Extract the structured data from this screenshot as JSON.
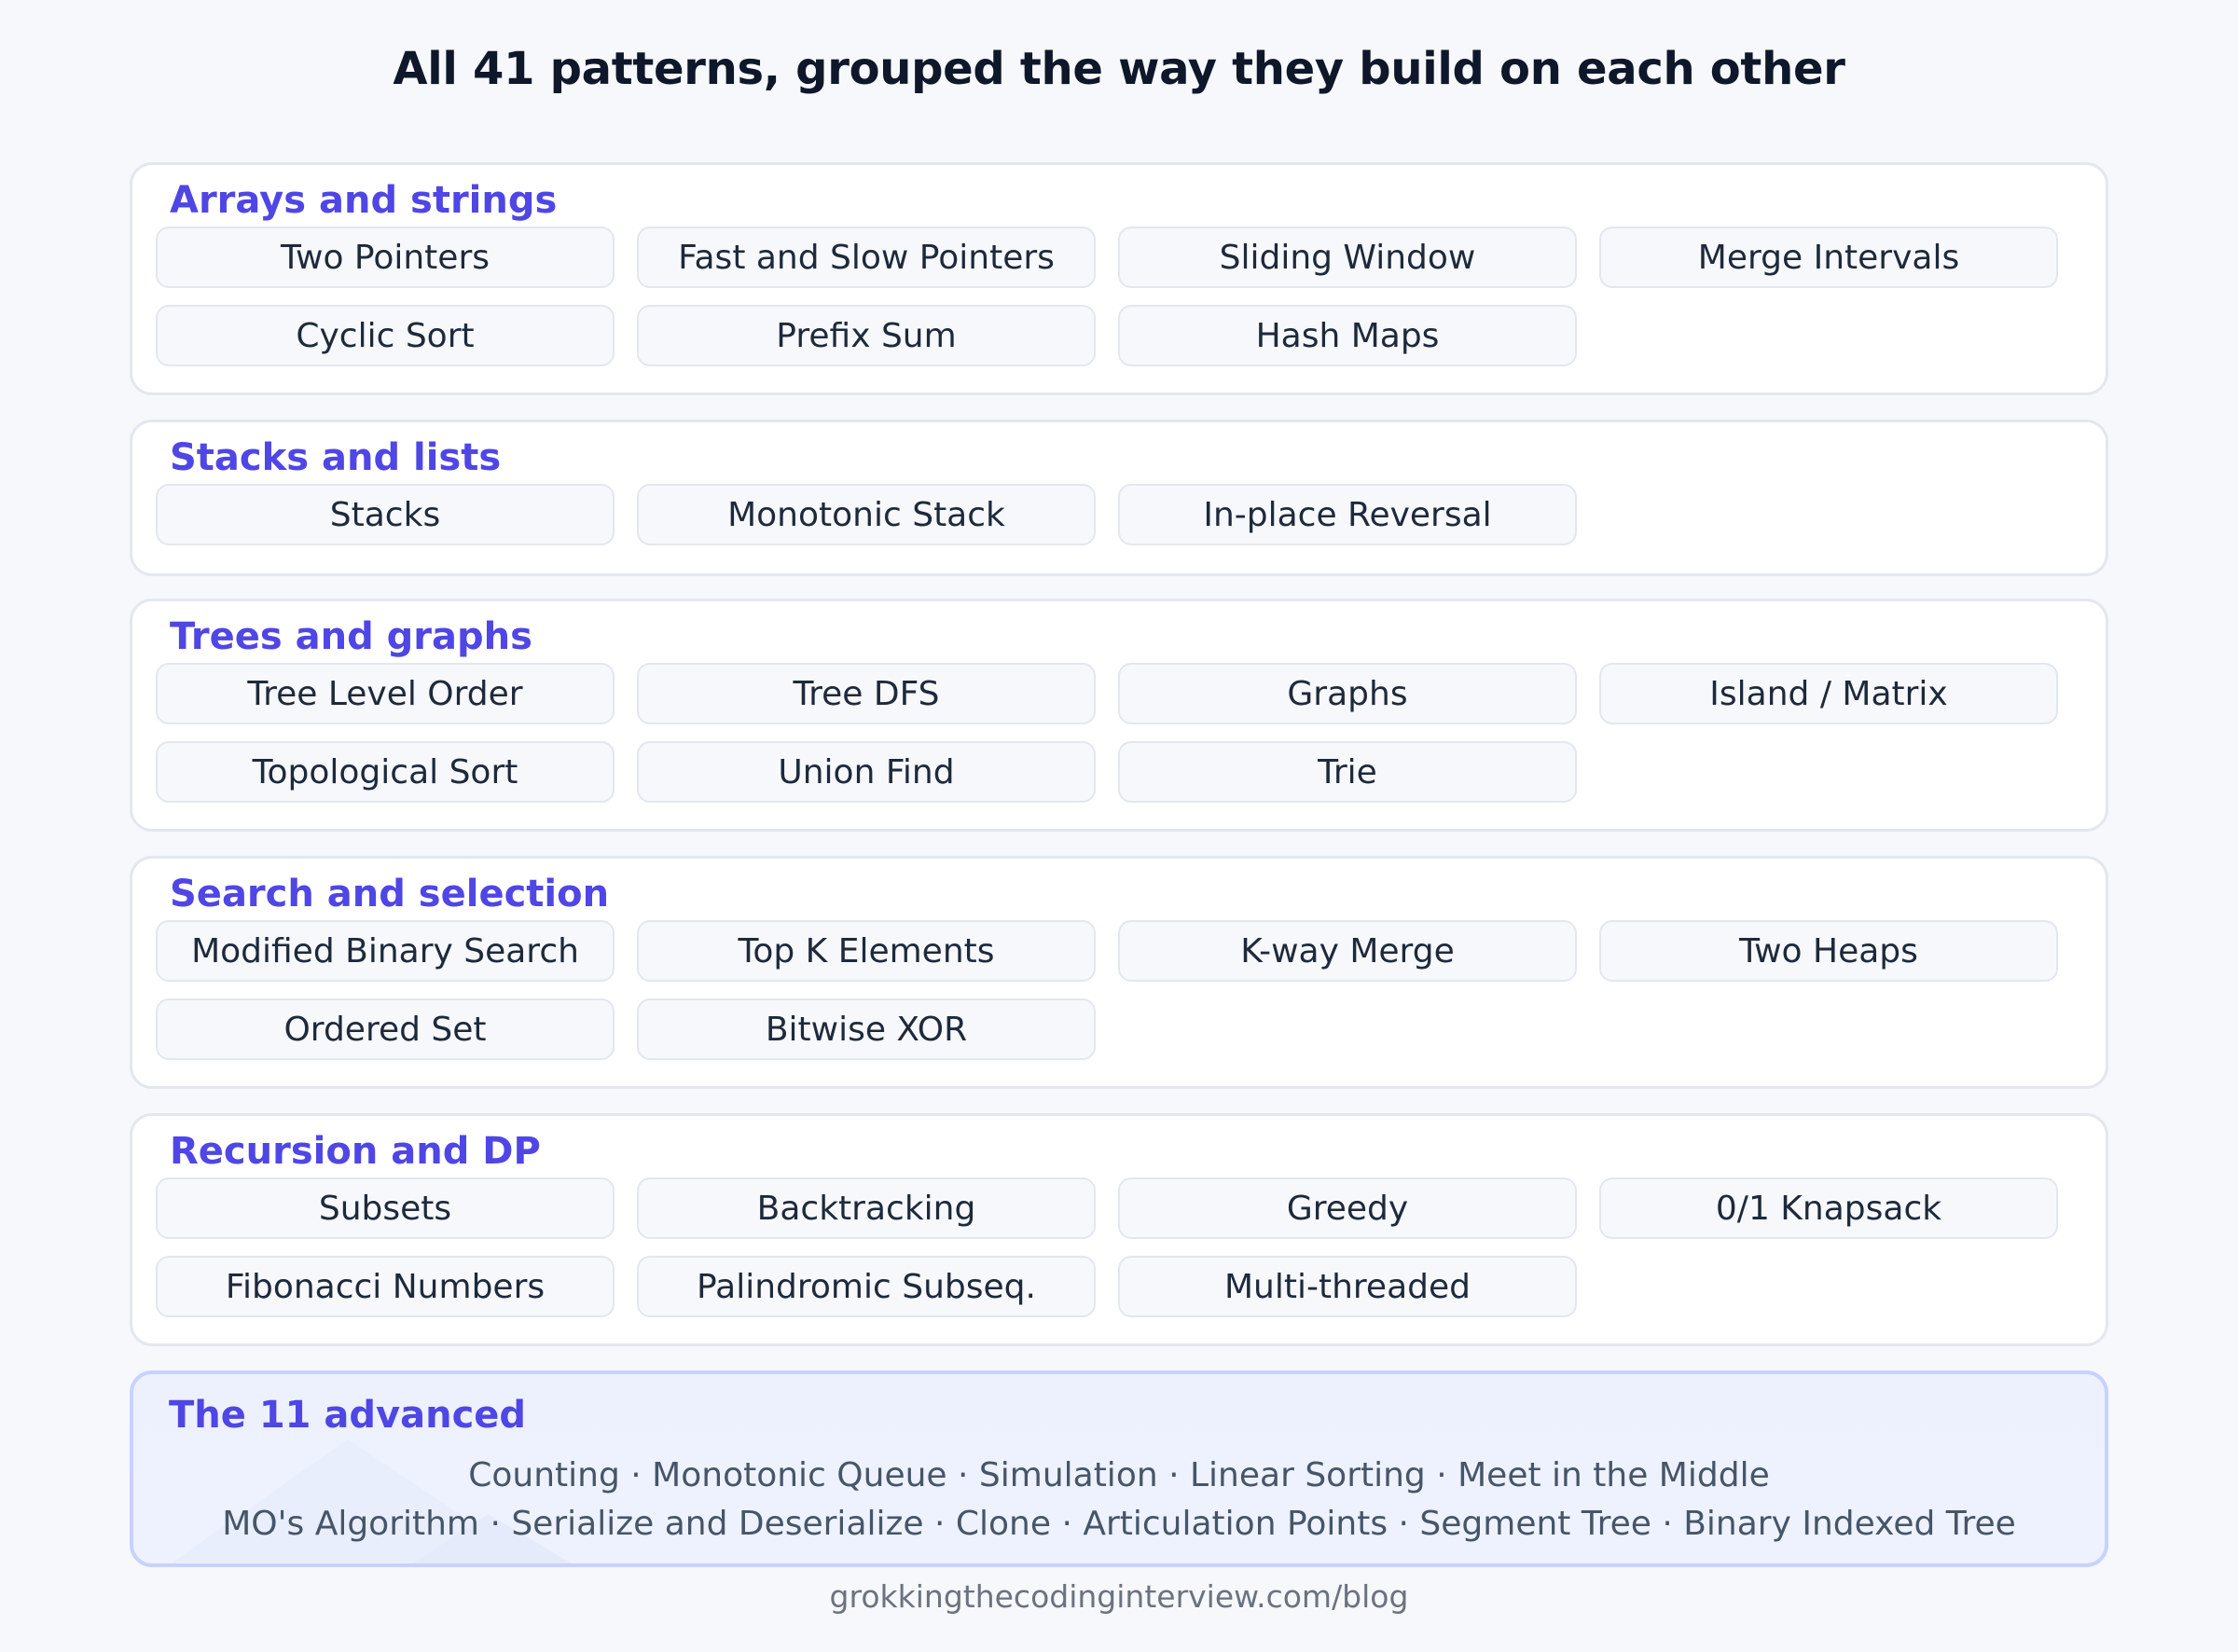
{
  "title": "All 41 patterns, grouped the way they build on each other",
  "groups": [
    {
      "title": "Arrays and strings",
      "patterns": [
        "Two Pointers",
        "Fast and Slow Pointers",
        "Sliding Window",
        "Merge Intervals",
        "Cyclic Sort",
        "Prefix Sum",
        "Hash Maps"
      ]
    },
    {
      "title": "Stacks and lists",
      "patterns": [
        "Stacks",
        "Monotonic Stack",
        "In-place Reversal"
      ]
    },
    {
      "title": "Trees and graphs",
      "patterns": [
        "Tree Level Order",
        "Tree DFS",
        "Graphs",
        "Island / Matrix",
        "Topological Sort",
        "Union Find",
        "Trie"
      ]
    },
    {
      "title": "Search and selection",
      "patterns": [
        "Modified Binary Search",
        "Top K Elements",
        "K-way Merge",
        "Two Heaps",
        "Ordered Set",
        "Bitwise XOR"
      ]
    },
    {
      "title": "Recursion and DP",
      "patterns": [
        "Subsets",
        "Backtracking",
        "Greedy",
        "0/1 Knapsack",
        "Fibonacci Numbers",
        "Palindromic Subseq.",
        "Multi-threaded"
      ]
    }
  ],
  "advanced": {
    "title": "The 11 advanced",
    "line1": "Counting · Monotonic Queue · Simulation · Linear Sorting · Meet in the Middle",
    "line2": "MO's Algorithm · Serialize and Deserialize · Clone · Articulation Points · Segment Tree · Binary Indexed Tree"
  },
  "footer": "grokkingthecodinginterview.com/blog"
}
